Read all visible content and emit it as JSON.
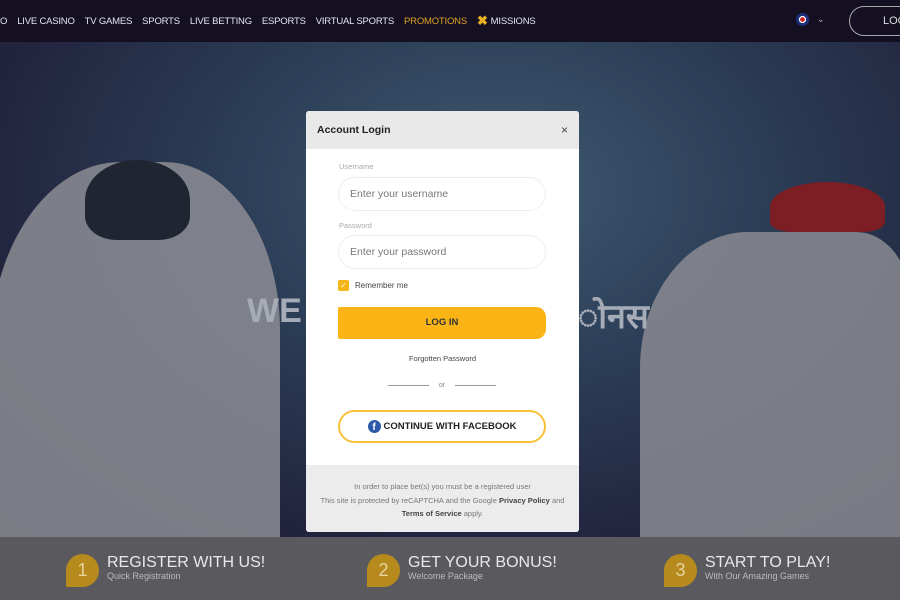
{
  "nav": {
    "items": [
      "O",
      "LIVE CASINO",
      "TV GAMES",
      "SPORTS",
      "LIVE BETTING",
      "ESPORTS",
      "VIRTUAL SPORTS",
      "PROMOTIONS",
      "MISSIONS"
    ],
    "active": "PROMOTIONS",
    "language_icon": "uk-flag-icon",
    "login_label": "LOG"
  },
  "hero": {
    "title_left": "WE",
    "title_right": "ोनस"
  },
  "modal": {
    "title": "Account Login",
    "close": "×",
    "username_label": "Username",
    "username_placeholder": "Enter your username",
    "password_label": "Password",
    "password_placeholder": "Enter your password",
    "remember": "Remember me",
    "remember_checked": true,
    "login_button": "LOG IN",
    "forgot": "Forgotten Password",
    "or": "or",
    "facebook_button": "CONTINUE WITH FACEBOOK",
    "footer_line1": "In order to place bet(s) you must be a registered user",
    "footer_line2_pre": "This site is protected by reCAPTCHA and the Google",
    "privacy_link": "Privacy Policy",
    "footer_and": "and",
    "terms_link": "Terms of Service",
    "footer_apply": "apply."
  },
  "steps": [
    {
      "num": "1",
      "title": "REGISTER WITH US!",
      "subtitle": "Quick Registration"
    },
    {
      "num": "2",
      "title": "GET YOUR BONUS!",
      "subtitle": "Welcome Package"
    },
    {
      "num": "3",
      "title": "START TO PLAY!",
      "subtitle": "With Our Amazing Games"
    }
  ],
  "colors": {
    "accent": "#fbb415",
    "nav_bg": "#150f22",
    "promo": "#e0a320",
    "facebook": "#2d5aa8"
  }
}
